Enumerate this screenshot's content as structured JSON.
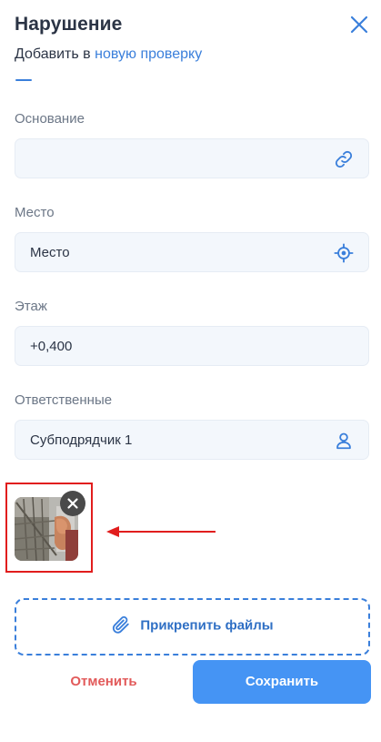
{
  "header": {
    "title": "Нарушение",
    "subtitle_prefix": "Добавить в",
    "subtitle_link": "новую проверку"
  },
  "fields": {
    "basis": {
      "label": "Основание",
      "value": "",
      "icon": "link-icon"
    },
    "place": {
      "label": "Место",
      "value": "Место",
      "icon": "crosshair-icon"
    },
    "floor": {
      "label": "Этаж",
      "value": "+0,400"
    },
    "responsible": {
      "label": "Ответственные",
      "value": "Субподрядчик 1",
      "icon": "user-icon"
    }
  },
  "attachments": {
    "count": 1,
    "remove_icon": "close-icon",
    "attach_label": "Прикрепить файлы",
    "attach_icon": "paperclip-icon"
  },
  "footer": {
    "cancel_label": "Отменить",
    "save_label": "Сохранить"
  },
  "colors": {
    "accent": "#3a7fdb",
    "save_button": "#4594f4",
    "cancel_text": "#e25a5a",
    "field_bg": "#f3f7fc",
    "annotation_red": "#e11d1d"
  }
}
